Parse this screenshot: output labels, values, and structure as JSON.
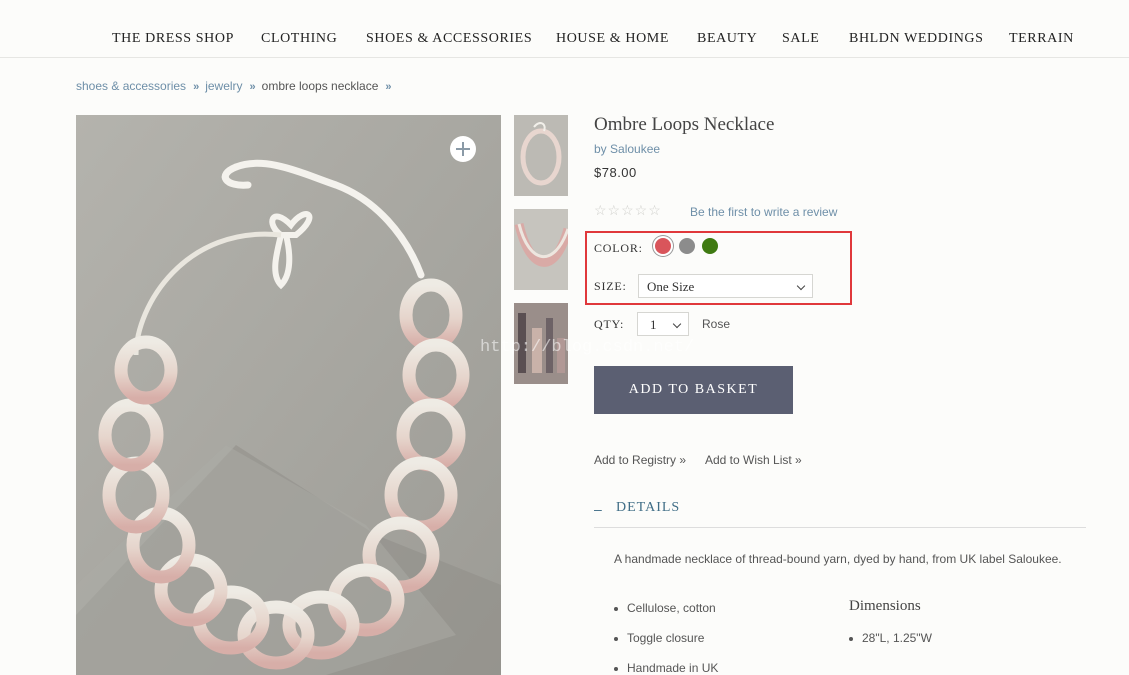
{
  "nav": {
    "items": [
      "THE DRESS SHOP",
      "CLOTHING",
      "SHOES & ACCESSORIES",
      "HOUSE & HOME",
      "BEAUTY",
      "SALE",
      "BHLDN WEDDINGS",
      "TERRAIN"
    ]
  },
  "breadcrumb": {
    "items": [
      "shoes & accessories",
      "jewelry",
      "ombre loops necklace"
    ],
    "separator": "»"
  },
  "product": {
    "title": "Ombre Loops Necklace",
    "by_prefix": "by",
    "brand": "Saloukee",
    "price": "$78.00",
    "rating_stars": "☆☆☆☆☆",
    "review_link": "Be the first to write a review",
    "color_label": "COLOR:",
    "colors": [
      {
        "name": "Rose",
        "hex": "#d9555b"
      },
      {
        "name": "Grey",
        "hex": "#8c8c8c"
      },
      {
        "name": "Green",
        "hex": "#3f7a12"
      }
    ],
    "selected_color": "Rose",
    "size_label": "SIZE:",
    "size_value": "One Size",
    "qty_label": "QTY:",
    "qty_value": "1",
    "add_to_basket": "ADD TO BASKET",
    "add_to_registry": "Add to Registry »",
    "add_to_wishlist": "Add to Wish List »"
  },
  "details": {
    "toggle": "–",
    "header": "DETAILS",
    "description": "A handmade necklace of thread-bound yarn, dyed by hand, from UK label Saloukee.",
    "features": [
      "Cellulose, cotton",
      "Toggle closure",
      "Handmade in UK"
    ],
    "dimensions_title": "Dimensions",
    "dimensions": [
      "28\"L, 1.25\"W"
    ]
  },
  "watermark": "http://blog.csdn.net/",
  "colors": {
    "link": "#6e8fa8",
    "button": "#5b5f72",
    "details_accent": "#3f6d86",
    "highlight": "#e0383b"
  }
}
